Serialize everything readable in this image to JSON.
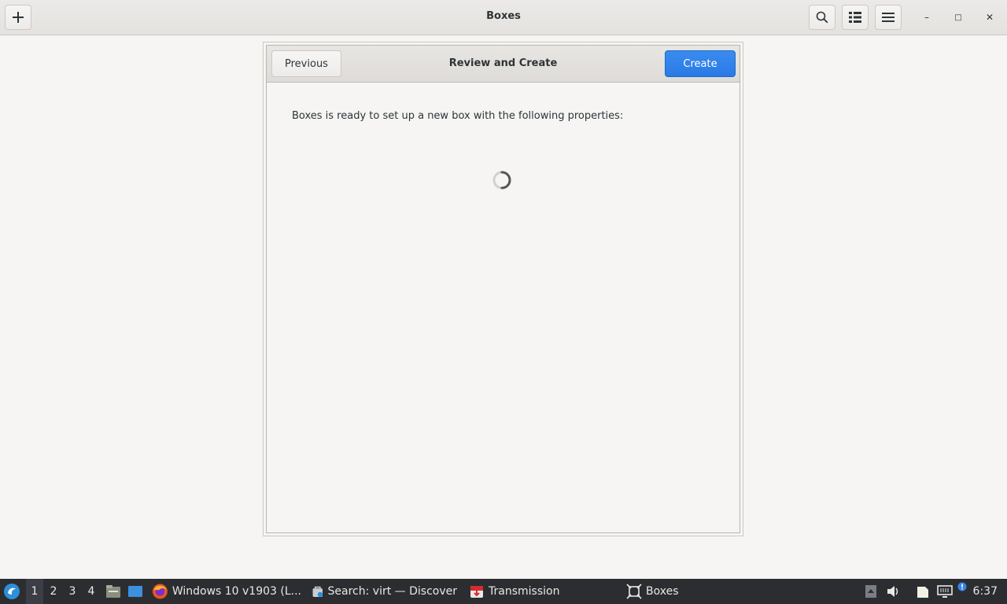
{
  "window": {
    "title": "Boxes",
    "new_icon": "plus-icon",
    "search_icon": "search-icon",
    "view_icon": "list-view-icon",
    "menu_icon": "hamburger-menu-icon",
    "minimize_glyph": "–",
    "maximize_glyph": "□",
    "close_glyph": "✕"
  },
  "dialog": {
    "previous_label": "Previous",
    "title": "Review and Create",
    "create_label": "Create",
    "message": "Boxes is ready to set up a new box with the following properties:",
    "loading": true
  },
  "taskbar": {
    "workspaces": [
      "1",
      "2",
      "3",
      "4"
    ],
    "active_workspace": "1",
    "tasks": [
      {
        "label": "Windows 10 v1903 (L...",
        "icon": "firefox-icon"
      },
      {
        "label": "Search: virt — Discover",
        "icon": "discover-icon"
      },
      {
        "label": "Transmission",
        "icon": "transmission-icon"
      },
      {
        "label": "Boxes",
        "icon": "boxes-icon"
      }
    ],
    "clock": "6:37",
    "accent": "#3584e4"
  }
}
